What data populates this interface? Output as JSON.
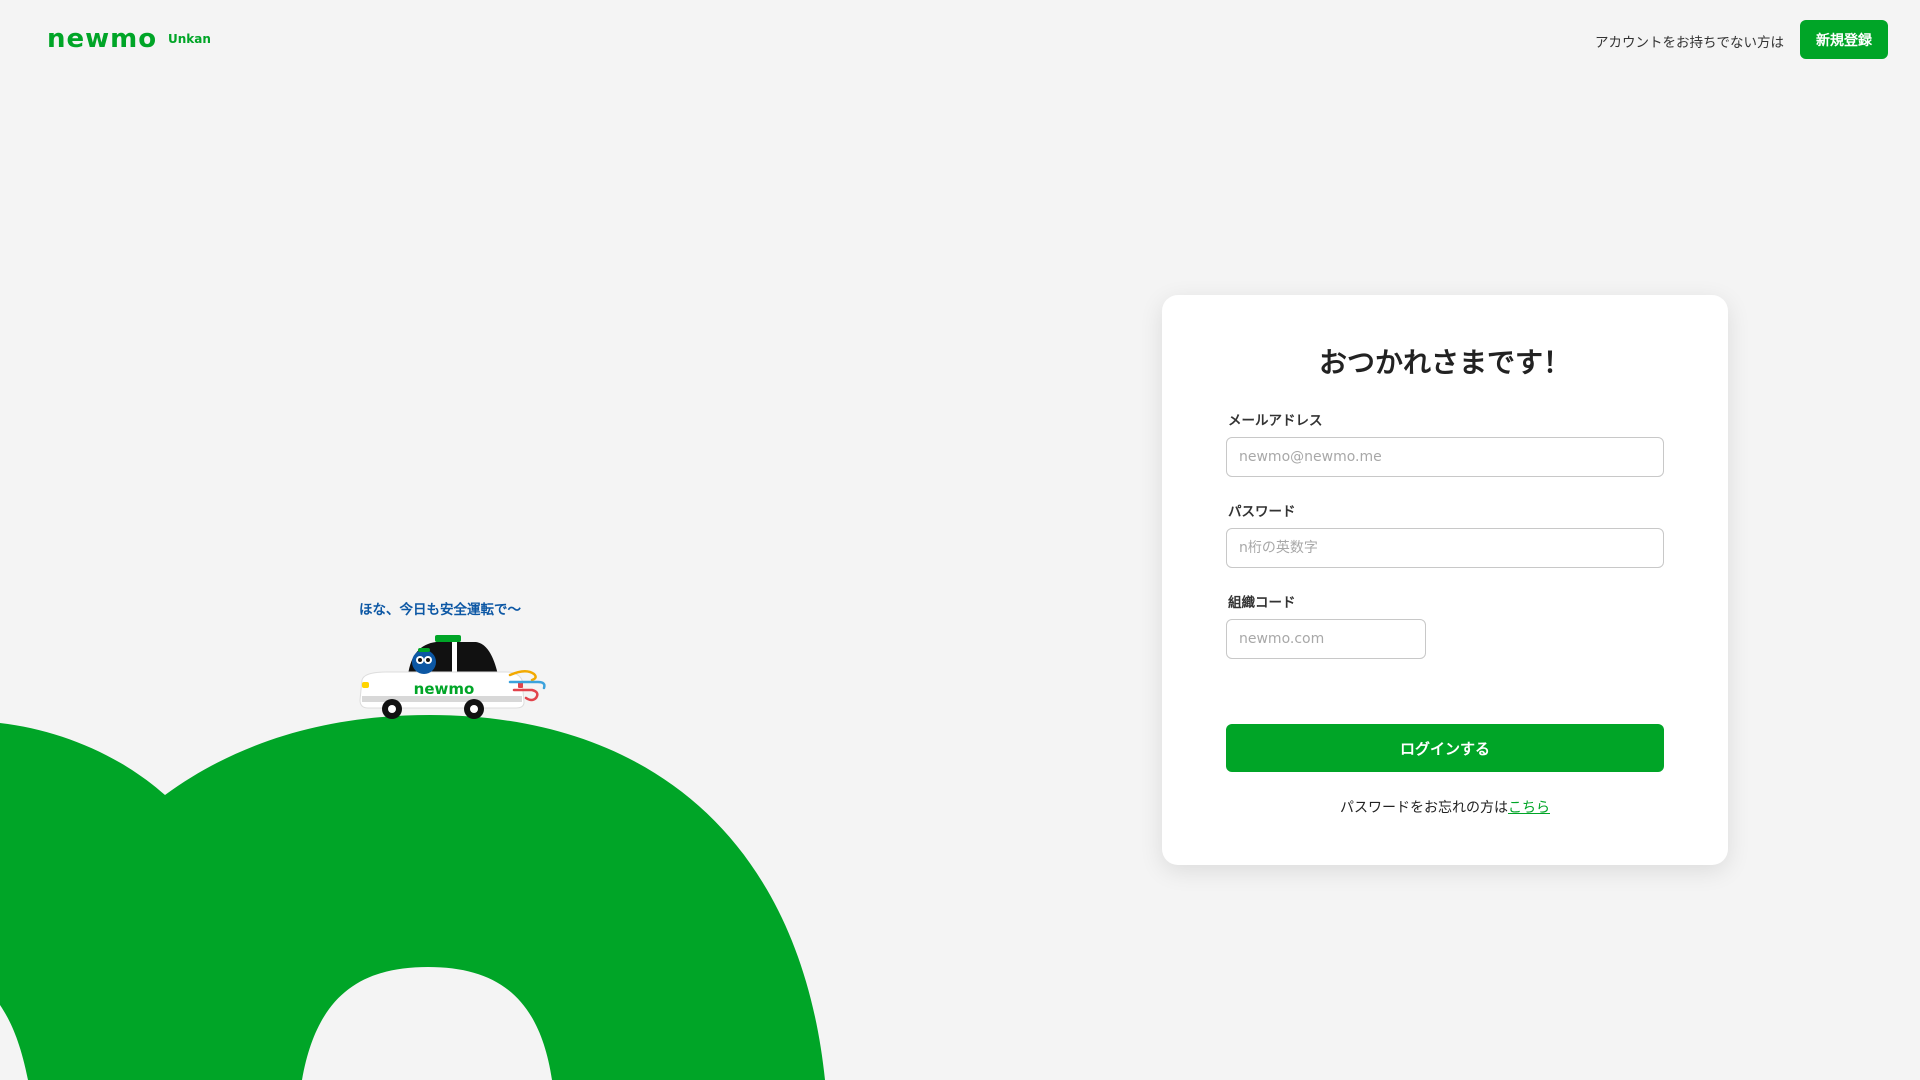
{
  "header": {
    "logo_text": "newmo",
    "product_name": "Unkan",
    "signup_prompt": "アカウントをお持ちでない方は",
    "signup_button": "新規登録"
  },
  "illustration": {
    "tagline": "ほな、今日も安全運転で〜",
    "car_logo_text": "newmo"
  },
  "login": {
    "title": "おつかれさまです！",
    "email_label": "メールアドレス",
    "email_placeholder": "newmo@newmo.me",
    "email_value": "",
    "password_label": "パスワード",
    "password_placeholder": "n桁の英数字",
    "password_value": "",
    "org_label": "組織コード",
    "org_placeholder": "newmo.com",
    "org_value": "",
    "submit_button": "ログインする",
    "forgot_prefix": "パスワードをお忘れの方は",
    "forgot_link": "こちら"
  },
  "colors": {
    "brand_green": "#00a527",
    "tagline_blue": "#0c57a4",
    "background": "#f4f4f4"
  }
}
